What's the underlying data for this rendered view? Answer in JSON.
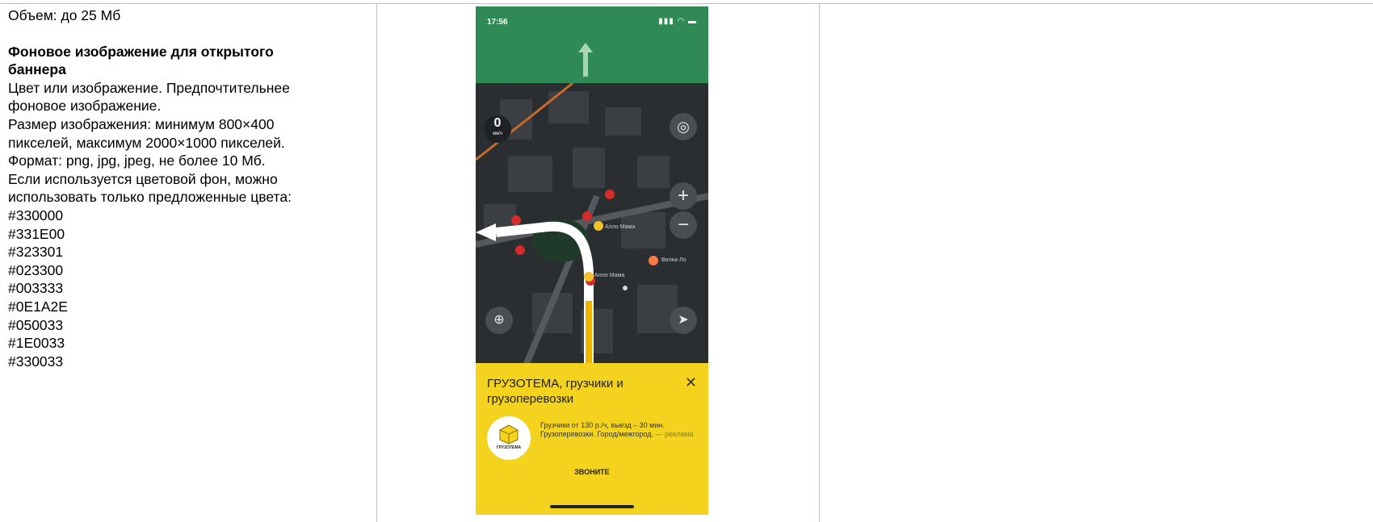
{
  "left_text": {
    "volume": "Объем: до 25 Мб",
    "heading_line1": "Фоновое изображение для открытого",
    "heading_line2": "баннера",
    "lines": [
      "Цвет или изображение. Предпочтительнее",
      "фоновое изображение.",
      "Размер изображения: минимум 800×400",
      "пикселей, максимум 2000×1000 пикселей.",
      "Формат: png, jpg, jpeg, не более 10 Мб.",
      "Если используется цветовой фон, можно",
      "использовать только предложенные цвета:"
    ],
    "colors": [
      "#330000",
      "#331E00",
      "#323301",
      "#023300",
      "#003333",
      "#0E1A2E",
      "#050033",
      "#1E0033",
      "#330033"
    ]
  },
  "phone": {
    "status_time": "17:56",
    "speed_value": "0",
    "speed_unit": "км/ч",
    "poi_labels": [
      "Алло Мама",
      "Алло Мама",
      "Вилка-Ло"
    ],
    "banner": {
      "title": "ГРУЗОТЕМА, грузчики и грузоперевозки",
      "body": "Грузчики от 130 р./ч, выезд – 30 мин. Грузоперевозки. Город/межгород.",
      "ad_label": "— реклама",
      "logo_text": "ГРУЗОТЕМА",
      "cta": "ЗВОНИТЕ"
    },
    "colors": {
      "nav_green": "#2f8a55",
      "banner_yellow": "#f4d31e",
      "map_dark": "#2b2e31"
    }
  }
}
